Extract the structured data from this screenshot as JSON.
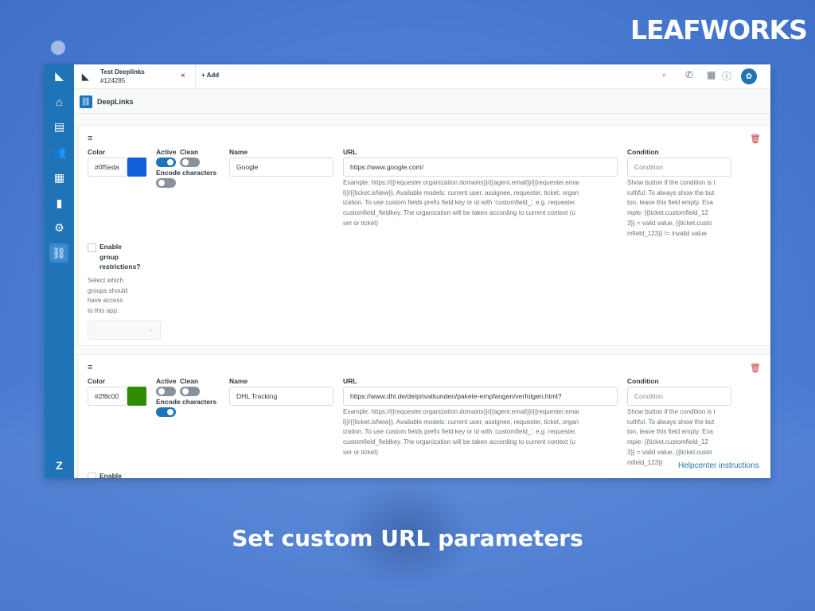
{
  "brand": {
    "logo_text": "LEAFWORKS"
  },
  "caption": "Set custom URL parameters",
  "colors": {
    "accent": "#1f73b7",
    "danger": "#cc3340"
  },
  "rail": {
    "icons": [
      "zendesk-logo-icon",
      "home-icon",
      "tickets-icon",
      "users-icon",
      "organizations-icon",
      "reporting-icon",
      "settings-icon",
      "link-icon",
      "zendesk-footer-icon"
    ]
  },
  "topbar": {
    "tab": {
      "title": "Test Deeplinks",
      "subtitle": "#124285",
      "close": "×"
    },
    "add_label": "+ Add"
  },
  "app": {
    "title": "DeepLinks"
  },
  "labels": {
    "color": "Color",
    "active": "Active",
    "clean": "Clean",
    "encode": "Encode characters",
    "name": "Name",
    "url": "URL",
    "condition": "Condition",
    "condition_placeholder": "Condition",
    "enable_group_1": "Enable",
    "enable_group_2": "group",
    "enable_group_3": "restrictions?"
  },
  "help": {
    "url_lines": [
      "Example: https://{{requester.organization.domains}}/{{agent.email}}/{{requester.emai",
      "l}}/{{ticket.isNew}}. Available models: current user, assignee, requester, ticket, organ",
      "ization. To use custom fields prefix field key or id with 'customfield_', e.g. requester.",
      "customfield_fieldkey. The organization will be taken according to current context (u",
      "ser or ticket)"
    ],
    "condition_lines": [
      "Show button if the condition is t",
      "ruthful. To always show the but",
      "ton, leave this field empty. Exa",
      "mple: {{ticket.customfield_12",
      "3}} = valid value, {{ticket.custo",
      "mfield_123}} != invalid value"
    ],
    "condition_lines_2": [
      "Show button if the condition is t",
      "ruthful. To always show the but",
      "ton, leave this field empty. Exa",
      "mple: {{ticket.customfield_12",
      "3}} = valid value, {{ticket.custo",
      "mfield_123}}"
    ],
    "groups_lines": [
      "Select which",
      "groups should",
      "have access",
      "to this app:"
    ]
  },
  "links": [
    {
      "color": "#0f5eda",
      "active": true,
      "clean": false,
      "encode": false,
      "name": "Google",
      "url": "https://www.google.com/"
    },
    {
      "color": "#2f8c00",
      "active": false,
      "clean": false,
      "encode": true,
      "name": "DHL Tracking",
      "url": "https://www.dhl.de/de/privatkunden/pakete-empfangen/verfolgen.html?"
    }
  ],
  "helpcenter": "Helpcenter instructions"
}
